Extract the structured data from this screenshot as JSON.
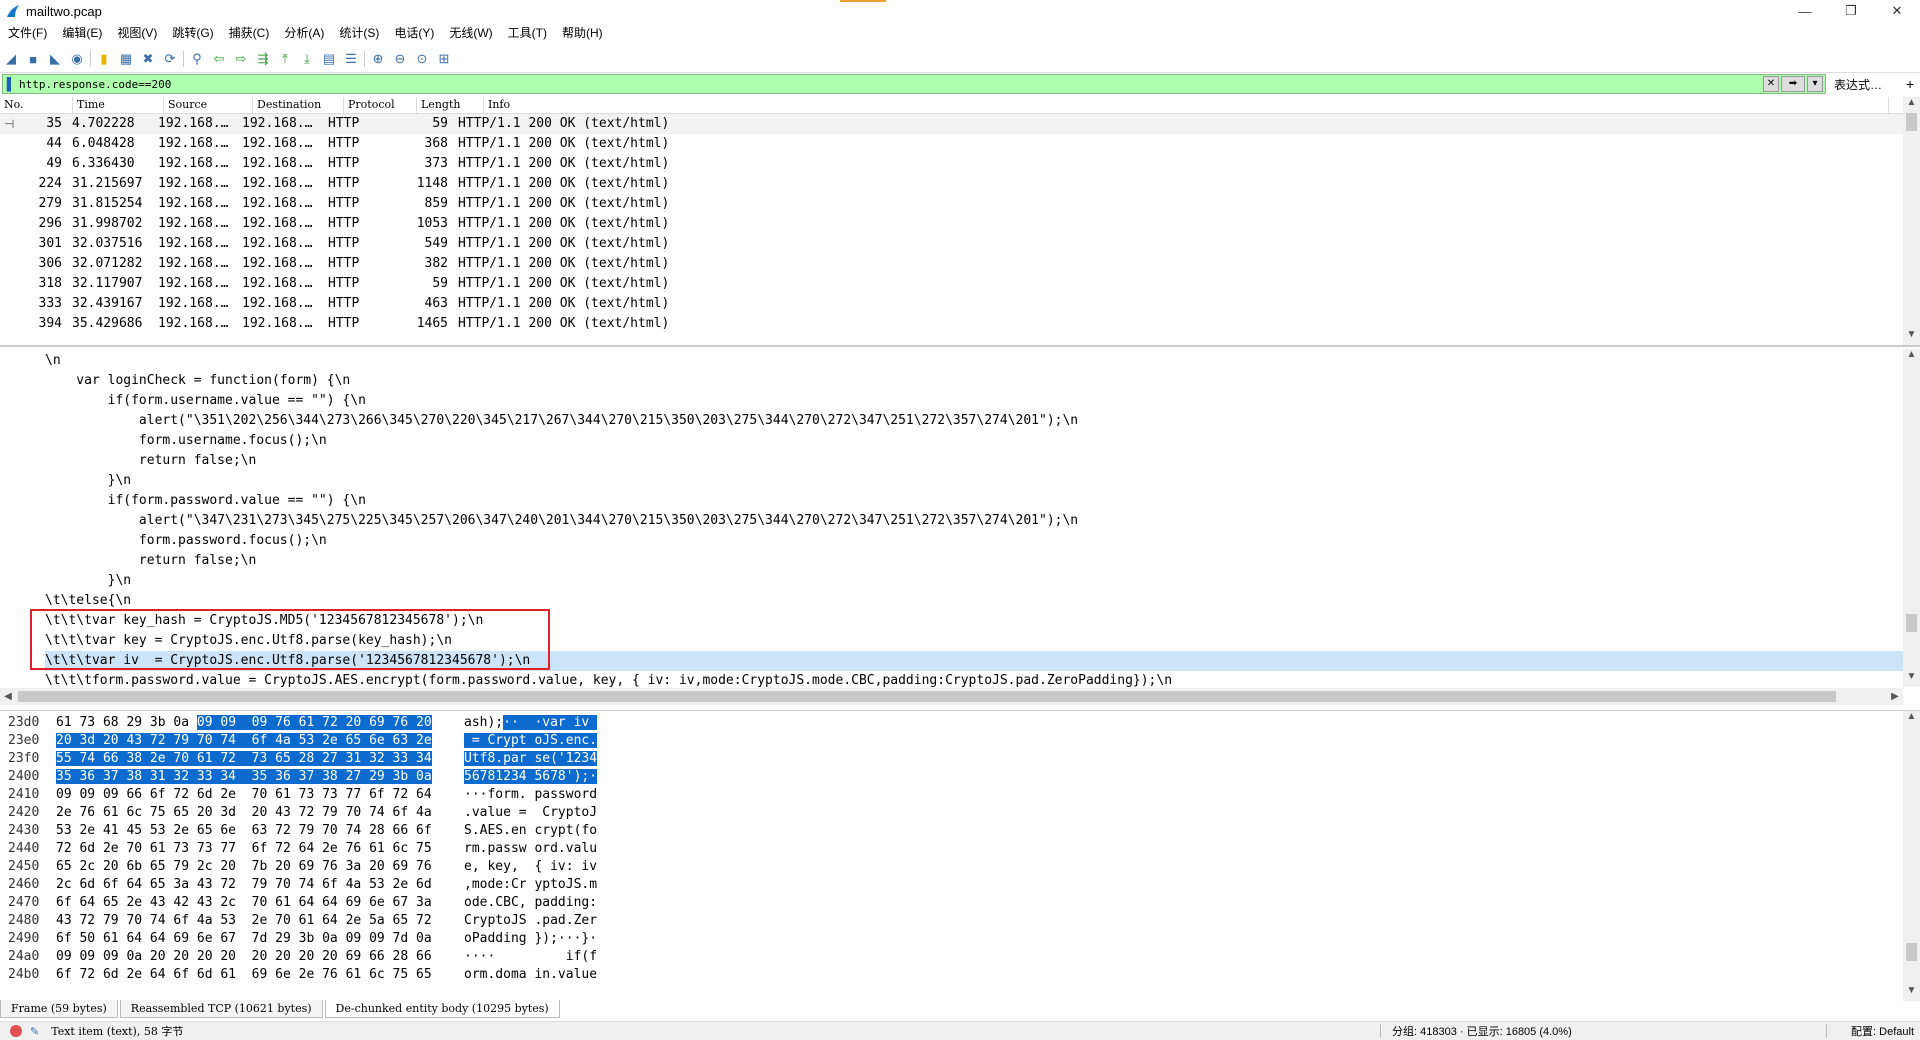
{
  "window": {
    "title": "mailtwo.pcap",
    "minimize": "—",
    "maximize": "❐",
    "close": "✕"
  },
  "menu": [
    "文件(F)",
    "编辑(E)",
    "视图(V)",
    "跳转(G)",
    "捕获(C)",
    "分析(A)",
    "统计(S)",
    "电话(Y)",
    "无线(W)",
    "工具(T)",
    "帮助(H)"
  ],
  "toolbar_icons": [
    "shark-start-icon",
    "stop-icon",
    "restart-icon",
    "options-icon",
    "open-file-icon",
    "save-file-icon",
    "close-file-icon",
    "reload-icon",
    "find-icon",
    "back-icon",
    "forward-icon",
    "goto-packet-icon",
    "first-packet-icon",
    "last-packet-icon",
    "autoscroll-icon",
    "colorize-icon",
    "zoom-in-icon",
    "zoom-out-icon",
    "zoom-normal-icon",
    "resize-columns-icon"
  ],
  "filter": {
    "value": "http.response.code==200",
    "expression_label": "表达式…",
    "plus_label": "+",
    "accent": "#afffaf"
  },
  "packet_columns": [
    "No.",
    "Time",
    "Source",
    "Destination",
    "Protocol",
    "Length",
    "Info"
  ],
  "packets": [
    {
      "no": "35",
      "time": "4.702228",
      "src": "192.168.…",
      "dst": "192.168.…",
      "proto": "HTTP",
      "len": "59",
      "info": "HTTP/1.1 200 OK  (text/html)"
    },
    {
      "no": "44",
      "time": "6.048428",
      "src": "192.168.…",
      "dst": "192.168.…",
      "proto": "HTTP",
      "len": "368",
      "info": "HTTP/1.1 200 OK  (text/html)"
    },
    {
      "no": "49",
      "time": "6.336430",
      "src": "192.168.…",
      "dst": "192.168.…",
      "proto": "HTTP",
      "len": "373",
      "info": "HTTP/1.1 200 OK  (text/html)"
    },
    {
      "no": "224",
      "time": "31.215697",
      "src": "192.168.…",
      "dst": "192.168.…",
      "proto": "HTTP",
      "len": "1148",
      "info": "HTTP/1.1 200 OK  (text/html)"
    },
    {
      "no": "279",
      "time": "31.815254",
      "src": "192.168.…",
      "dst": "192.168.…",
      "proto": "HTTP",
      "len": "859",
      "info": "HTTP/1.1 200 OK  (text/html)"
    },
    {
      "no": "296",
      "time": "31.998702",
      "src": "192.168.…",
      "dst": "192.168.…",
      "proto": "HTTP",
      "len": "1053",
      "info": "HTTP/1.1 200 OK  (text/html)"
    },
    {
      "no": "301",
      "time": "32.037516",
      "src": "192.168.…",
      "dst": "192.168.…",
      "proto": "HTTP",
      "len": "549",
      "info": "HTTP/1.1 200 OK  (text/html)"
    },
    {
      "no": "306",
      "time": "32.071282",
      "src": "192.168.…",
      "dst": "192.168.…",
      "proto": "HTTP",
      "len": "382",
      "info": "HTTP/1.1 200 OK  (text/html)"
    },
    {
      "no": "318",
      "time": "32.117907",
      "src": "192.168.…",
      "dst": "192.168.…",
      "proto": "HTTP",
      "len": "59",
      "info": "HTTP/1.1 200 OK  (text/html)"
    },
    {
      "no": "333",
      "time": "32.439167",
      "src": "192.168.…",
      "dst": "192.168.…",
      "proto": "HTTP",
      "len": "463",
      "info": "HTTP/1.1 200 OK  (text/html)"
    },
    {
      "no": "394",
      "time": "35.429686",
      "src": "192.168.…",
      "dst": "192.168.…",
      "proto": "HTTP",
      "len": "1465",
      "info": "HTTP/1.1 200 OK  (text/html)"
    }
  ],
  "detail_lines": [
    "\\n",
    "    var loginCheck = function(form) {\\n",
    "        if(form.username.value == \"\") {\\n",
    "            alert(\"\\351\\202\\256\\344\\273\\266\\345\\270\\220\\345\\217\\267\\344\\270\\215\\350\\203\\275\\344\\270\\272\\347\\251\\272\\357\\274\\201\");\\n",
    "            form.username.focus();\\n",
    "            return false;\\n",
    "        }\\n",
    "        if(form.password.value == \"\") {\\n",
    "            alert(\"\\347\\231\\273\\345\\275\\225\\345\\257\\206\\347\\240\\201\\344\\270\\215\\350\\203\\275\\344\\270\\272\\347\\251\\272\\357\\274\\201\");\\n",
    "            form.password.focus();\\n",
    "            return false;\\n",
    "        }\\n",
    "\\t\\telse{\\n",
    "\\t\\t\\tvar key_hash = CryptoJS.MD5('1234567812345678');\\n",
    "\\t\\t\\tvar key = CryptoJS.enc.Utf8.parse(key_hash);\\n",
    "\\t\\t\\tvar iv  = CryptoJS.enc.Utf8.parse('1234567812345678');\\n",
    "\\t\\t\\tform.password.value = CryptoJS.AES.encrypt(form.password.value, key, { iv: iv,mode:CryptoJS.mode.CBC,padding:CryptoJS.pad.ZeroPadding});\\n"
  ],
  "bytes": [
    {
      "off": "23d0",
      "hex": [
        "61 73 68 29 3b 0a ",
        "09 09  09 76 61 72 20 69 76 20"
      ],
      "asc": [
        "ash);",
        "··  ·var iv "
      ]
    },
    {
      "off": "23e0",
      "hex": [
        "",
        "20 3d 20 43 72 79 70 74  6f 4a 53 2e 65 6e 63 2e"
      ],
      "asc": [
        "",
        " = Crypt oJS.enc."
      ]
    },
    {
      "off": "23f0",
      "hex": [
        "",
        "55 74 66 38 2e 70 61 72  73 65 28 27 31 32 33 34"
      ],
      "asc": [
        "",
        "Utf8.par se('1234"
      ]
    },
    {
      "off": "2400",
      "hex": [
        "",
        "35 36 37 38 31 32 33 34  35 36 37 38 27 29 3b 0a"
      ],
      "asc": [
        "",
        "56781234 5678');·"
      ]
    },
    {
      "off": "2410",
      "hex": [
        "09 09 09 66 6f 72 6d 2e  70 61 73 73 77 6f 72 64",
        ""
      ],
      "asc": [
        "···form. password",
        ""
      ]
    },
    {
      "off": "2420",
      "hex": [
        "2e 76 61 6c 75 65 20 3d  20 43 72 79 70 74 6f 4a",
        ""
      ],
      "asc": [
        ".value =  CryptoJ",
        ""
      ]
    },
    {
      "off": "2430",
      "hex": [
        "53 2e 41 45 53 2e 65 6e  63 72 79 70 74 28 66 6f",
        ""
      ],
      "asc": [
        "S.AES.en crypt(fo",
        ""
      ]
    },
    {
      "off": "2440",
      "hex": [
        "72 6d 2e 70 61 73 73 77  6f 72 64 2e 76 61 6c 75",
        ""
      ],
      "asc": [
        "rm.passw ord.valu",
        ""
      ]
    },
    {
      "off": "2450",
      "hex": [
        "65 2c 20 6b 65 79 2c 20  7b 20 69 76 3a 20 69 76",
        ""
      ],
      "asc": [
        "e, key,  { iv: iv",
        ""
      ]
    },
    {
      "off": "2460",
      "hex": [
        "2c 6d 6f 64 65 3a 43 72  79 70 74 6f 4a 53 2e 6d",
        ""
      ],
      "asc": [
        ",mode:Cr yptoJS.m",
        ""
      ]
    },
    {
      "off": "2470",
      "hex": [
        "6f 64 65 2e 43 42 43 2c  70 61 64 64 69 6e 67 3a",
        ""
      ],
      "asc": [
        "ode.CBC, padding:",
        ""
      ]
    },
    {
      "off": "2480",
      "hex": [
        "43 72 79 70 74 6f 4a 53  2e 70 61 64 2e 5a 65 72",
        ""
      ],
      "asc": [
        "CryptoJS .pad.Zer",
        ""
      ]
    },
    {
      "off": "2490",
      "hex": [
        "6f 50 61 64 64 69 6e 67  7d 29 3b 0a 09 09 7d 0a",
        ""
      ],
      "asc": [
        "oPadding });···}·",
        ""
      ]
    },
    {
      "off": "24a0",
      "hex": [
        "09 09 09 0a 20 20 20 20  20 20 20 20 69 66 28 66",
        ""
      ],
      "asc": [
        "····         if(f",
        ""
      ]
    },
    {
      "off": "24b0",
      "hex": [
        "6f 72 6d 2e 64 6f 6d 61  69 6e 2e 76 61 6c 75 65",
        ""
      ],
      "asc": [
        "orm.doma in.value",
        ""
      ]
    }
  ],
  "tabs": [
    "Frame (59 bytes)",
    "Reassembled TCP (10621 bytes)",
    "De-chunked entity body (10295 bytes)"
  ],
  "status": {
    "text": "Text item (text), 58 字节",
    "stats": "分组: 418303 · 已显示: 16805 (4.0%)",
    "profile": "配置: Default"
  },
  "colors": {
    "selection": "#0d6bcf",
    "highlight_line": "#cce4f7",
    "annotation_box": "#e0202a"
  }
}
